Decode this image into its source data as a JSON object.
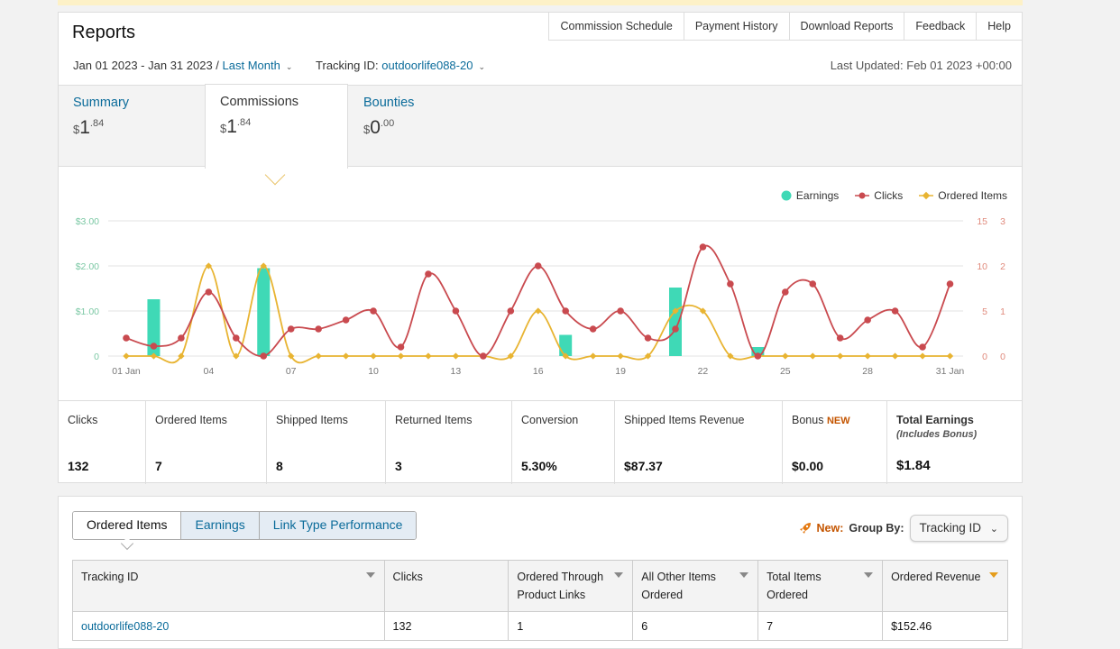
{
  "header": {
    "title": "Reports",
    "links": [
      "Commission Schedule",
      "Payment History",
      "Download Reports",
      "Feedback",
      "Help"
    ],
    "date_range": "Jan 01 2023 - Jan 31 2023",
    "date_sep": " / ",
    "period": "Last Month",
    "tracking_label": "Tracking ID:",
    "tracking_id": "outdoorlife088-20",
    "last_updated": "Last Updated: Feb 01 2023 +00:00"
  },
  "tabs": [
    {
      "label": "Summary",
      "currency": "$",
      "whole": "1",
      "cents": ".84"
    },
    {
      "label": "Commissions",
      "currency": "$",
      "whole": "1",
      "cents": ".84"
    },
    {
      "label": "Bounties",
      "currency": "$",
      "whole": "0",
      "cents": ".00"
    }
  ],
  "chart_data": {
    "type": "line",
    "legend": [
      "Earnings",
      "Clicks",
      "Ordered Items"
    ],
    "x_tick_labels": [
      "01 Jan",
      "04",
      "07",
      "10",
      "13",
      "16",
      "19",
      "22",
      "25",
      "28",
      "31 Jan"
    ],
    "y_left_ticks": [
      "0",
      "$1.00",
      "$2.00",
      "$3.00"
    ],
    "y_right1_ticks": [
      "0",
      "5",
      "10",
      "15"
    ],
    "y_right2_ticks": [
      "0",
      "1",
      "2",
      "3"
    ],
    "days": [
      1,
      2,
      3,
      4,
      5,
      6,
      7,
      8,
      9,
      10,
      11,
      12,
      13,
      14,
      15,
      16,
      17,
      18,
      19,
      20,
      21,
      22,
      23,
      24,
      25,
      26,
      27,
      28,
      29,
      30,
      31
    ],
    "series": [
      {
        "name": "Earnings",
        "type": "bar",
        "color": "#3fd9b6",
        "ylim": [
          0,
          3
        ],
        "values": [
          0,
          1.26,
          0,
          0,
          0,
          1.95,
          0,
          0,
          0,
          0,
          0,
          0,
          0,
          0,
          0,
          0,
          0.47,
          0,
          0,
          0,
          1.52,
          0,
          0,
          0.2,
          0,
          0,
          0,
          0,
          0,
          0,
          0
        ]
      },
      {
        "name": "Clicks",
        "type": "line",
        "color": "#c94a4f",
        "ylim": [
          0,
          15
        ],
        "values": [
          2,
          1.1,
          2,
          7.1,
          2,
          0,
          3,
          3,
          4,
          5,
          1,
          9.1,
          5,
          0,
          5,
          10,
          5,
          3,
          5,
          2,
          3,
          12.1,
          8,
          0,
          7.1,
          8,
          2,
          4,
          5,
          1,
          8
        ]
      },
      {
        "name": "Ordered Items",
        "type": "line",
        "color": "#e8b432",
        "ylim": [
          0,
          3
        ],
        "values": [
          0,
          0,
          0,
          2,
          0,
          2,
          0,
          0,
          0,
          0,
          0,
          0,
          0,
          0,
          0,
          1,
          0,
          0,
          0,
          0,
          1,
          1,
          0,
          0,
          0,
          0,
          0,
          0,
          0,
          0,
          0
        ]
      }
    ],
    "grid": true,
    "legend_position": "top-right"
  },
  "stats": [
    {
      "label": "Clicks",
      "value": "132"
    },
    {
      "label": "Ordered Items",
      "value": "7"
    },
    {
      "label": "Shipped Items",
      "value": "8"
    },
    {
      "label": "Returned Items",
      "value": "3"
    },
    {
      "label": "Conversion",
      "value": "5.30%"
    },
    {
      "label": "Shipped Items Revenue",
      "value": "$87.37"
    },
    {
      "label": "Bonus",
      "badge": "NEW",
      "value": "$0.00"
    },
    {
      "label": "Total Earnings",
      "sublabel": "(Includes Bonus)",
      "value": "$1.84"
    }
  ],
  "subtabs": [
    "Ordered Items",
    "Earnings",
    "Link Type Performance"
  ],
  "groupby": {
    "new_label": "New:",
    "label": "Group By:",
    "selected": "Tracking ID"
  },
  "table": {
    "headers": [
      "Tracking ID",
      "Clicks",
      "Ordered Through Product Links",
      "All Other Items Ordered",
      "Total Items Ordered",
      "Ordered Revenue"
    ],
    "rows": [
      [
        "outdoorlife088-20",
        "132",
        "1",
        "6",
        "7",
        "$152.46"
      ]
    ]
  },
  "colors": {
    "accent": "#0a6b9a",
    "earnings": "#3fd9b6",
    "clicks": "#c94a4f",
    "ordered": "#e8b432"
  }
}
